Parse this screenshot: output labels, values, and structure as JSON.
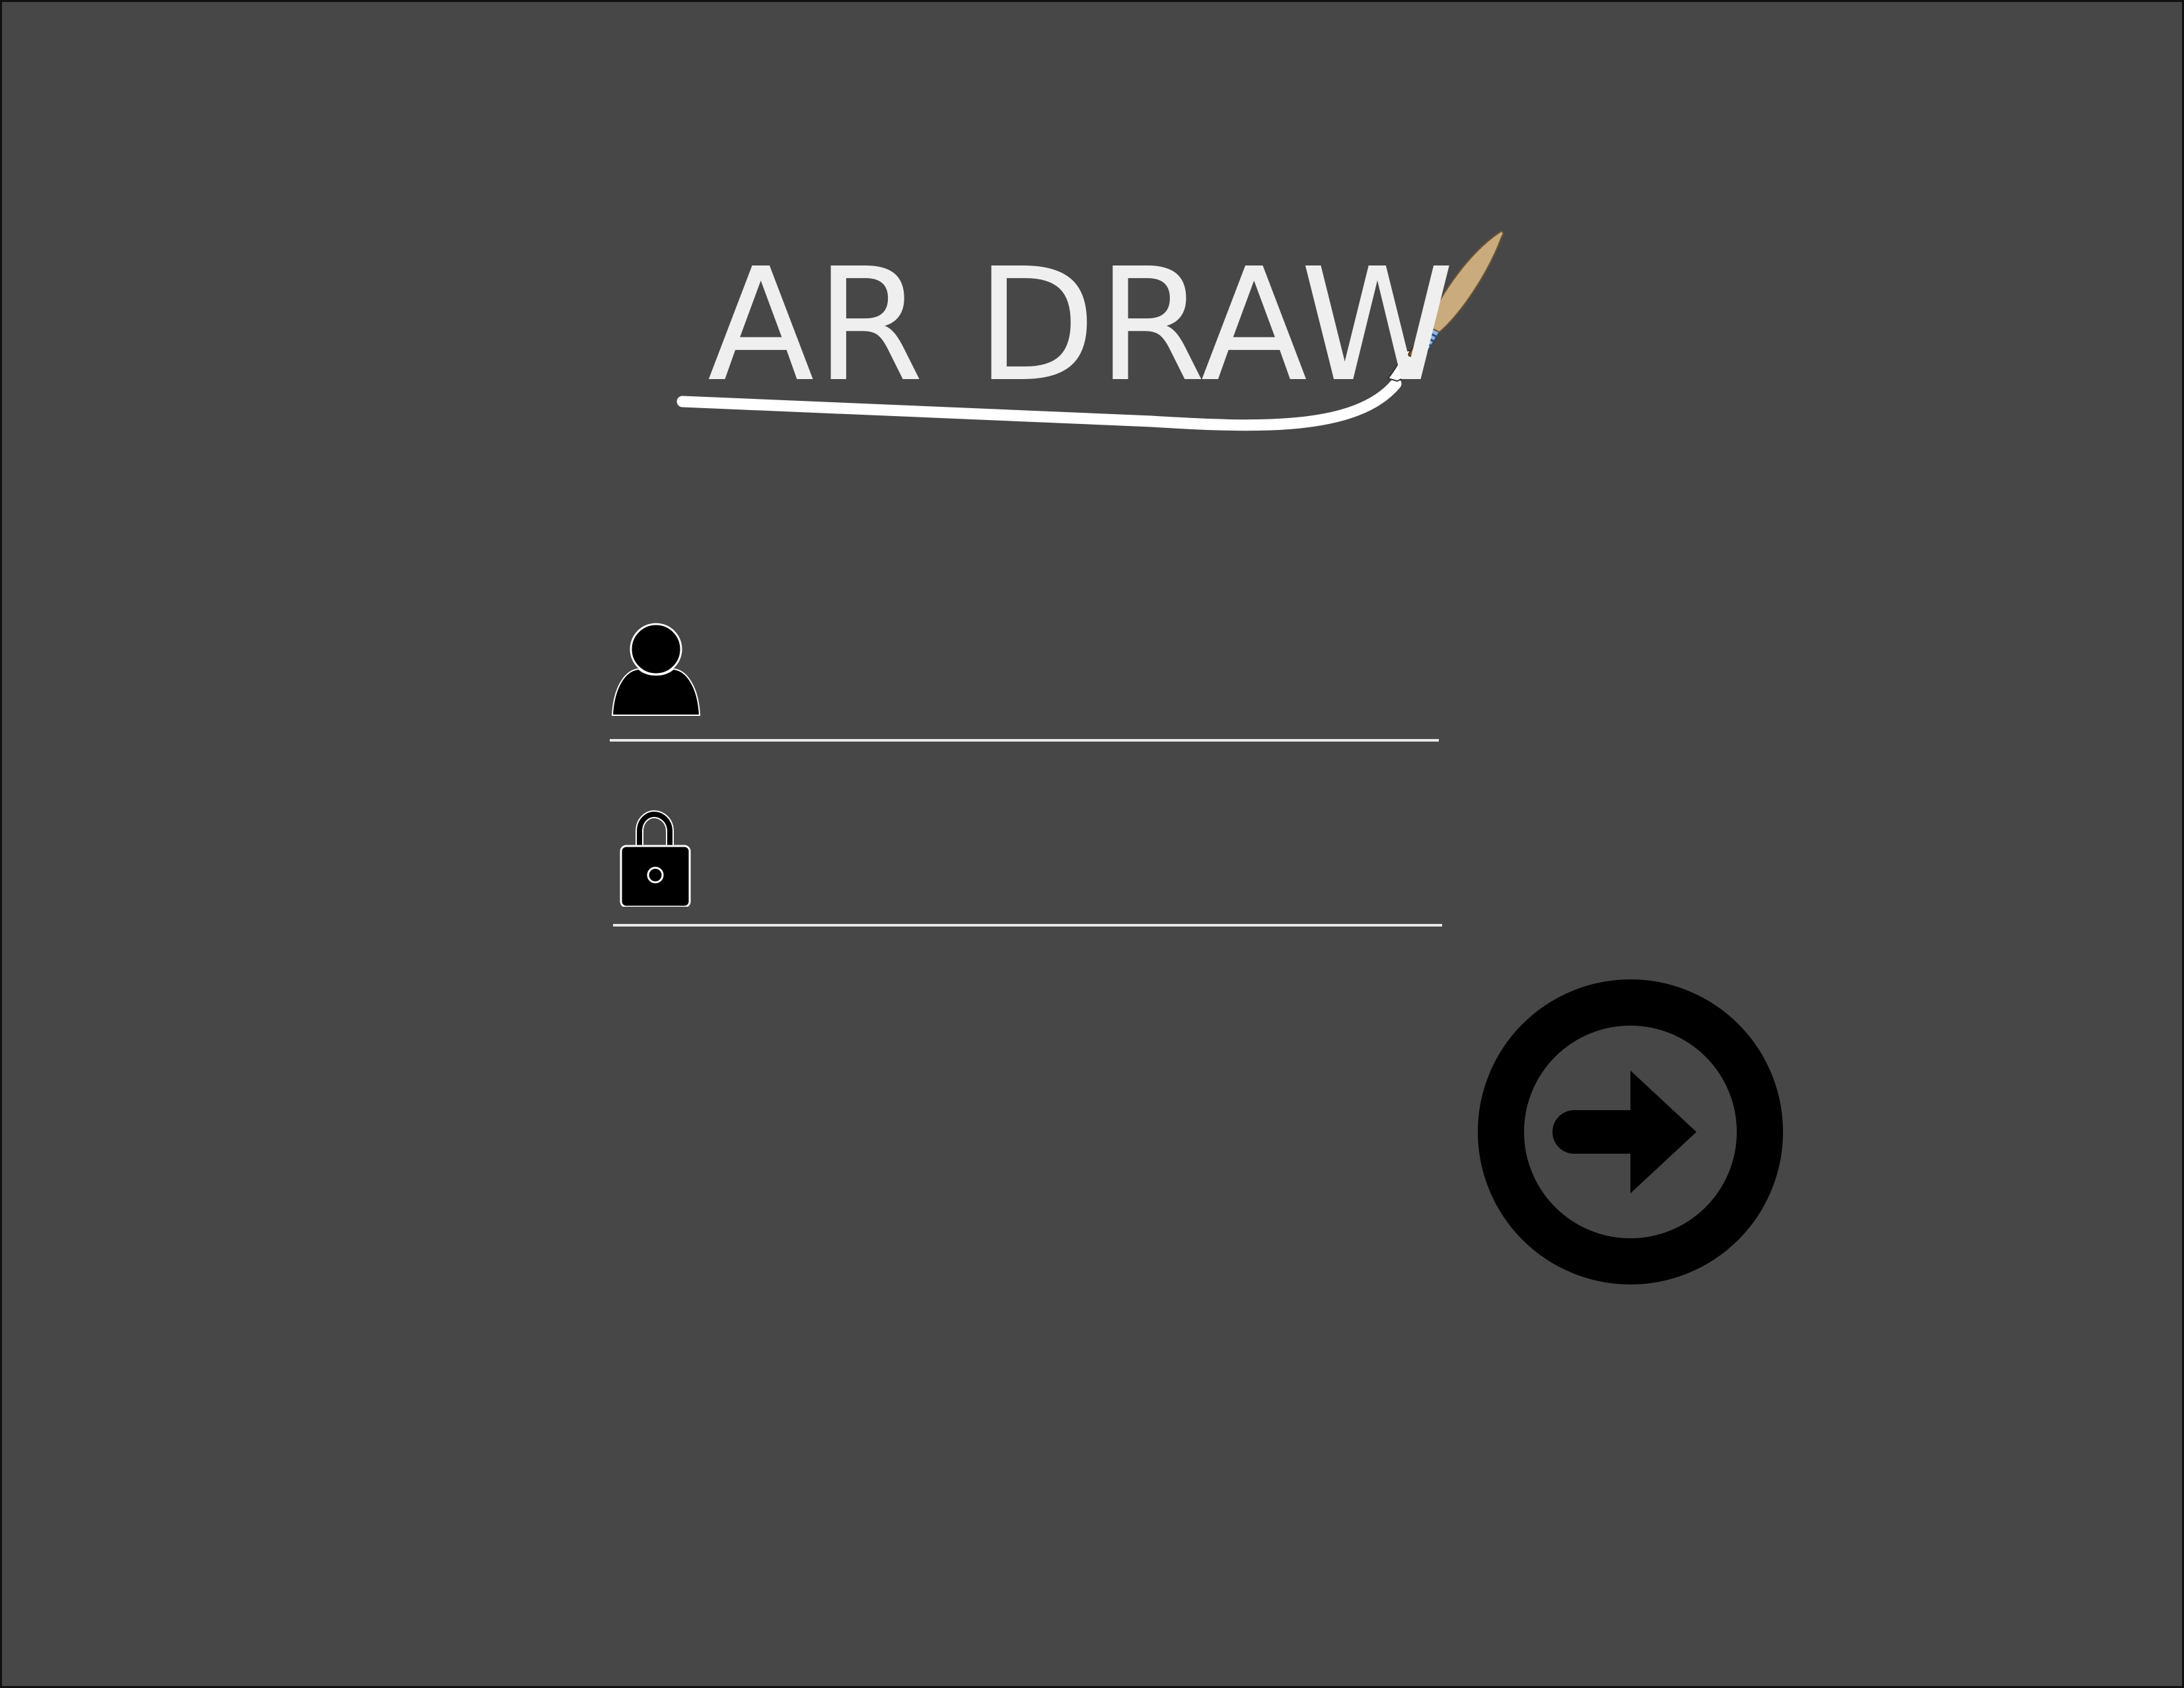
{
  "app": {
    "title": "AR DRAW"
  },
  "logo": {
    "icon": "paintbrush-icon",
    "brush_handle_color": "#c9ab7d",
    "brush_ferrule_color": "#8db3e0",
    "brush_tip_color": "#8b5a2b",
    "stroke_color": "#ffffff"
  },
  "login_form": {
    "username": {
      "icon": "user-icon",
      "value": "",
      "placeholder": ""
    },
    "password": {
      "icon": "lock-icon",
      "value": "",
      "placeholder": ""
    },
    "submit": {
      "icon": "arrow-right-circle-icon"
    }
  },
  "colors": {
    "background": "#474747",
    "text": "#efefef",
    "icon": "#000000"
  }
}
